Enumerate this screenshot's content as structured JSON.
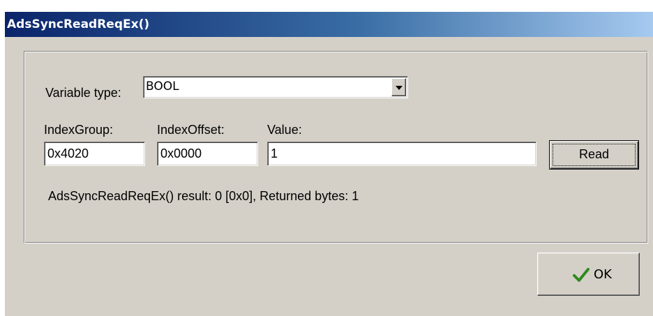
{
  "window": {
    "title": "AdsSyncReadReqEx()"
  },
  "form": {
    "variable_type_label": "Variable type:",
    "variable_type_value": "BOOL",
    "index_group_label": "IndexGroup:",
    "index_group_value": "0x4020",
    "index_offset_label": "IndexOffset:",
    "index_offset_value": "0x0000",
    "value_label": "Value:",
    "value_value": "1",
    "read_button_label": "Read",
    "result_text": "AdsSyncReadReqEx() result: 0 [0x0], Returned bytes: 1"
  },
  "footer": {
    "ok_button_label": "OK",
    "ok_icon": "check-icon",
    "ok_icon_color": "#2f8a1e"
  }
}
